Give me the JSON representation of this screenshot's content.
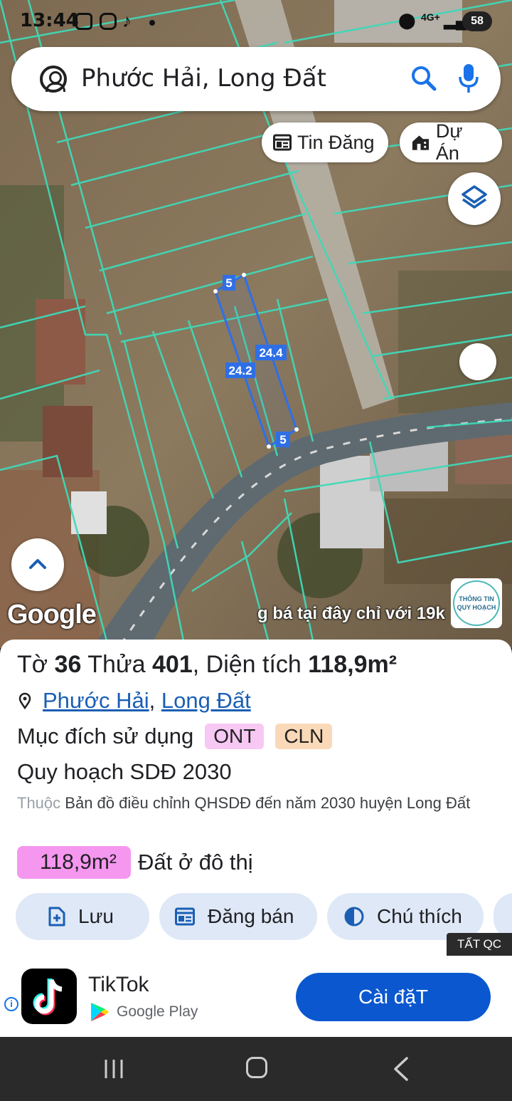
{
  "status_bar": {
    "time": "13:44",
    "network": "4G+",
    "battery": "58"
  },
  "search": {
    "query": "Phước Hải, Long Đất"
  },
  "map": {
    "chips": {
      "tin_dang": "Tin Đăng",
      "du_an": "Dự Án"
    },
    "plot_labels": {
      "top": "5",
      "left_side": "24.2",
      "right_side": "24.4",
      "bottom": "5"
    },
    "google_logo": "Google",
    "ticker_text": "g bá tại đây chỉ với 19k",
    "info_badge": {
      "line1": "THÔNG TIN",
      "line2": "QUY HOẠCH"
    }
  },
  "parcel": {
    "to_label": "Tờ",
    "to_value": "36",
    "thua_label": "Thửa",
    "thua_value": "401",
    "area_label": "Diện tích",
    "area_value": "118,9m²",
    "location_part1": "Phước Hải",
    "location_sep": ", ",
    "location_part2": "Long Đất",
    "purpose_label": "Mục đích sử dụng",
    "purpose_tags": [
      "ONT",
      "CLN"
    ],
    "plan": "Quy hoạch SDĐ 2030",
    "belongs_prefix": "Thuộc",
    "belongs_text": "Bản đồ điều chỉnh QHSDĐ đến năm 2030 huyện Long Đất",
    "zone_area": "118,9m²",
    "zone_label": "Đất ở đô thị"
  },
  "actions": {
    "save": "Lưu",
    "post": "Đăng bán",
    "legend": "Chú thích"
  },
  "ad": {
    "tag": "TẤT QC",
    "app_name": "TikTok",
    "store": "Google Play",
    "install": "Cài đặT"
  },
  "colors": {
    "parcel_line": "#3fd9b8",
    "plot_outline": "#2f6fe6",
    "install_button": "#0b57d0",
    "zone_pill": "#f597ef"
  }
}
